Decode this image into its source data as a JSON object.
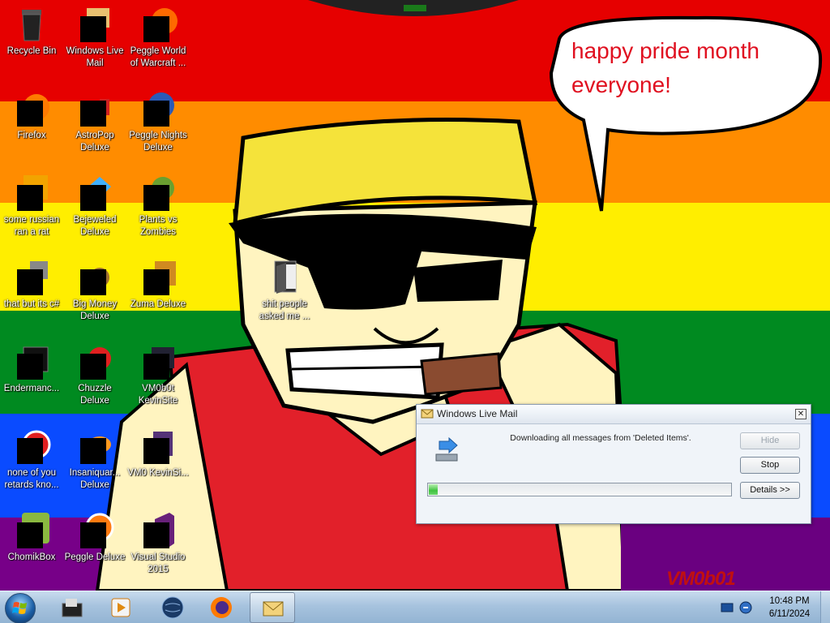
{
  "wallpaper": {
    "stripes": [
      "#e60000",
      "#ff8c00",
      "#ffee00",
      "#008a20",
      "#0a4bff",
      "#770088"
    ],
    "speech_bubble_text": "happy pride month everyone!",
    "signature": "VM0b01"
  },
  "desktop_icons": [
    {
      "label": "Recycle Bin",
      "icon": "recycle-bin-icon"
    },
    {
      "label": "Windows Live Mail",
      "icon": "windows-live-mail-icon"
    },
    {
      "label": "Peggle World of Warcraft ...",
      "icon": "peggle-world-of-warcraft-icon"
    },
    {
      "label": "Firefox",
      "icon": "firefox-icon"
    },
    {
      "label": "AstroPop Deluxe",
      "icon": "astropop-deluxe-icon"
    },
    {
      "label": "Peggle Nights Deluxe",
      "icon": "peggle-nights-deluxe-icon"
    },
    {
      "label": "some russian ran a rat",
      "icon": "shortcut-icon"
    },
    {
      "label": "Bejeweled Deluxe",
      "icon": "bejeweled-deluxe-icon"
    },
    {
      "label": "Plants vs Zombies",
      "icon": "plants-vs-zombies-icon"
    },
    {
      "label": "that but its c#",
      "icon": "shortcut-icon"
    },
    {
      "label": "Big Money Deluxe",
      "icon": "big-money-deluxe-icon"
    },
    {
      "label": "Zuma Deluxe",
      "icon": "zuma-deluxe-icon"
    },
    {
      "label": "Endermanc...",
      "icon": "endermanch-icon"
    },
    {
      "label": "Chuzzle Deluxe",
      "icon": "chuzzle-deluxe-icon"
    },
    {
      "label": "VM0b0t KevinSite",
      "icon": "vm0b0t-icon"
    },
    {
      "label": "none of you retards kno...",
      "icon": "shortcut-icon"
    },
    {
      "label": "Insaniquar... Deluxe",
      "icon": "insaniquarium-deluxe-icon"
    },
    {
      "label": "VM0 KevinSi...",
      "icon": "vm0-icon"
    },
    {
      "label": "ChomikBox",
      "icon": "chomikbox-icon"
    },
    {
      "label": "Peggle Deluxe",
      "icon": "peggle-deluxe-icon"
    },
    {
      "label": "Visual Studio 2015",
      "icon": "visual-studio-icon"
    },
    {
      "label": "shit people asked me ...",
      "icon": "folder-icon"
    }
  ],
  "wlm_dialog": {
    "title": "Windows Live Mail",
    "message": "Downloading all messages from 'Deleted Items'.",
    "progress": 0.03,
    "buttons": {
      "hide": "Hide",
      "stop": "Stop",
      "details": "Details >>"
    }
  },
  "taskbar": {
    "items": [
      "start-button",
      "file-explorer-icon",
      "media-player-icon",
      "globe-icon",
      "firefox-icon",
      "windows-live-mail-icon"
    ],
    "active_item": "windows-live-mail-icon",
    "clock_time": "10:48 PM",
    "clock_date": "6/11/2024"
  }
}
